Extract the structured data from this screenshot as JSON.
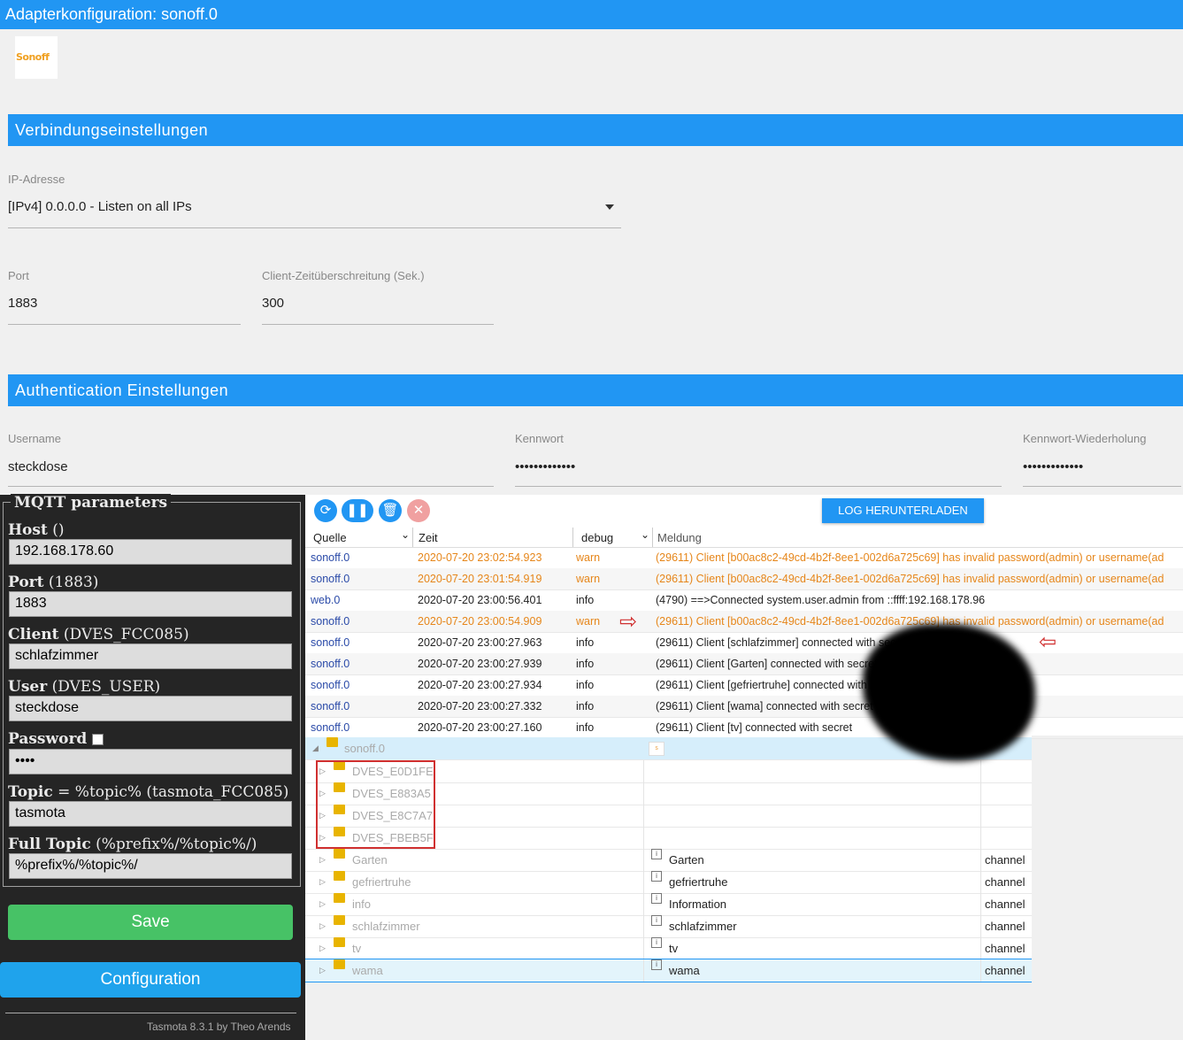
{
  "window": {
    "title": "Adapterkonfiguration: sonoff.0"
  },
  "logo": {
    "text": "Sonoff"
  },
  "sections": {
    "connection": "Verbindungseinstellungen",
    "auth": "Authentication Einstellungen"
  },
  "connection": {
    "ip_label": "IP-Adresse",
    "ip_value": "[IPv4] 0.0.0.0 - Listen on all IPs",
    "port_label": "Port",
    "port_value": "1883",
    "timeout_label": "Client-Zeitüberschreitung (Sek.)",
    "timeout_value": "300"
  },
  "auth": {
    "user_label": "Username",
    "user_value": "steckdose",
    "pw_label": "Kennwort",
    "pw_value": "•••••••••••••",
    "pw2_label": "Kennwort-Wiederholung",
    "pw2_value": "•••••••••••••"
  },
  "tasmota": {
    "legend": "MQTT parameters",
    "host_label": "Host",
    "host_hint": " ()",
    "host_value": "192.168.178.60",
    "port_label": "Port",
    "port_hint": " (1883)",
    "port_value": "1883",
    "client_label": "Client",
    "client_hint": " (DVES_FCC085)",
    "client_value": "schlafzimmer",
    "user_label": "User",
    "user_hint": " (DVES_USER)",
    "user_value": "steckdose",
    "password_label": "Password",
    "password_value": "••••",
    "topic_label": "Topic",
    "topic_hint": " = %topic% (tasmota_FCC085)",
    "topic_value": "tasmota",
    "fulltopic_label": "Full Topic",
    "fulltopic_hint": " (%prefix%/%topic%/)",
    "fulltopic_value": "%prefix%/%topic%/",
    "save_label": "Save",
    "config_label": "Configuration",
    "footer": "Tasmota 8.3.1 by Theo Arends"
  },
  "log": {
    "download_label": "LOG HERUNTERLADEN",
    "col_source": "Quelle",
    "col_time": "Zeit",
    "col_level": "debug",
    "col_message": "Meldung",
    "rows": [
      {
        "source": "sonoff.0",
        "time": "2020-07-20 23:02:54.923",
        "level": "warn",
        "message": "(29611) Client [b00ac8c2-49cd-4b2f-8ee1-002d6a725c69] has invalid password(admin) or username(ad"
      },
      {
        "source": "sonoff.0",
        "time": "2020-07-20 23:01:54.919",
        "level": "warn",
        "message": "(29611) Client [b00ac8c2-49cd-4b2f-8ee1-002d6a725c69] has invalid password(admin) or username(ad"
      },
      {
        "source": "web.0",
        "time": "2020-07-20 23:00:56.401",
        "level": "info",
        "message": "(4790) ==>Connected system.user.admin from ::ffff:192.168.178.96"
      },
      {
        "source": "sonoff.0",
        "time": "2020-07-20 23:00:54.909",
        "level": "warn",
        "message": "(29611) Client [b00ac8c2-49cd-4b2f-8ee1-002d6a725c69] has invalid password(admin) or username(ad"
      },
      {
        "source": "sonoff.0",
        "time": "2020-07-20 23:00:27.963",
        "level": "info",
        "message": "(29611) Client [schlafzimmer] connected with secret"
      },
      {
        "source": "sonoff.0",
        "time": "2020-07-20 23:00:27.939",
        "level": "info",
        "message": "(29611) Client [Garten] connected with secret"
      },
      {
        "source": "sonoff.0",
        "time": "2020-07-20 23:00:27.934",
        "level": "info",
        "message": "(29611) Client [gefriertruhe] connected with secret"
      },
      {
        "source": "sonoff.0",
        "time": "2020-07-20 23:00:27.332",
        "level": "info",
        "message": "(29611) Client [wama] connected with secret"
      },
      {
        "source": "sonoff.0",
        "time": "2020-07-20 23:00:27.160",
        "level": "info",
        "message": "(29611) Client [tv] connected with secret"
      }
    ]
  },
  "tree": {
    "root": "sonoff.0",
    "rows": [
      {
        "name": "DVES_E0D1FE",
        "desc": "",
        "type": ""
      },
      {
        "name": "DVES_E883A5",
        "desc": "",
        "type": ""
      },
      {
        "name": "DVES_E8C7A7",
        "desc": "",
        "type": ""
      },
      {
        "name": "DVES_FBEB5F",
        "desc": "",
        "type": ""
      },
      {
        "name": "Garten",
        "desc": "Garten",
        "type": "channel"
      },
      {
        "name": "gefriertruhe",
        "desc": "gefriertruhe",
        "type": "channel"
      },
      {
        "name": "info",
        "desc": "Information",
        "type": "channel"
      },
      {
        "name": "schlafzimmer",
        "desc": "schlafzimmer",
        "type": "channel"
      },
      {
        "name": "tv",
        "desc": "tv",
        "type": "channel"
      },
      {
        "name": "wama",
        "desc": "wama",
        "type": "channel"
      }
    ]
  },
  "colors": {
    "accent": "#2196f3",
    "save": "#47c266",
    "config": "#1fa3ec",
    "warn": "#e6861a"
  }
}
